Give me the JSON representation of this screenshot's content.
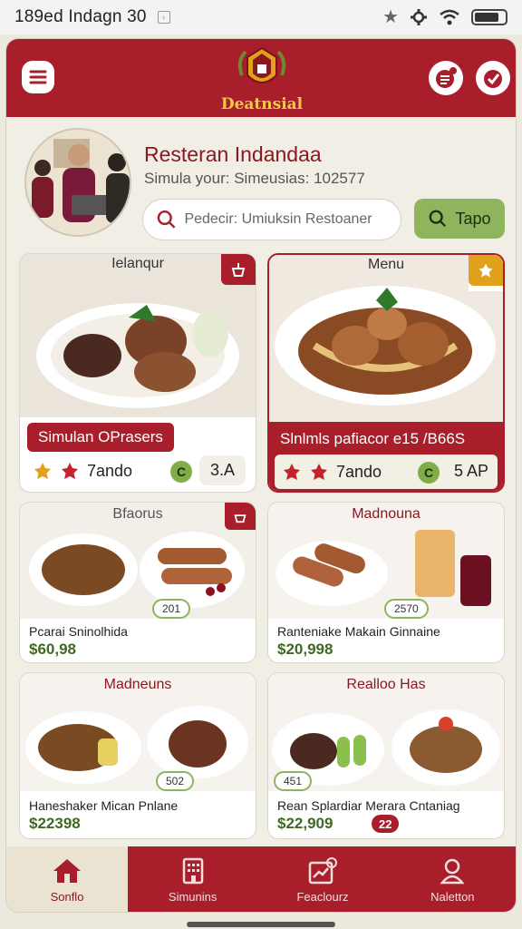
{
  "status_bar": {
    "time": "189ed Indagn 30"
  },
  "header": {
    "brand": "Deatnsial",
    "accent": "#a81e2a"
  },
  "restaurant": {
    "title": "Resteran Indandaa",
    "subtitle": "Simula your: Simeusias: 102577"
  },
  "search": {
    "placeholder": "Pedecir: Umiuksin Restoaner",
    "button_label": "Tapo"
  },
  "featured": [
    {
      "title": "Ielanqur",
      "banner": "Simulan OPrasers",
      "rating_label": "7ando",
      "pill": "3.A"
    },
    {
      "title": "Menu",
      "banner": "Slnlmls pafiacor e15 /B66S",
      "rating_label": "7ando",
      "pill": "5 AP"
    }
  ],
  "items": [
    {
      "title": "Bfaorus",
      "qty": "201",
      "name": "Pcarai Sninolhida",
      "price": "$60,98"
    },
    {
      "title": "Madnouna",
      "qty": "2570",
      "name": "Ranteniake Makain Ginnaine",
      "price": "$20,998"
    },
    {
      "title": "Madneuns",
      "qty": "502",
      "name": "Haneshaker Mican Pnlane",
      "price": "$22398"
    },
    {
      "title": "Realloo Has",
      "qty": "451",
      "name": "Rean Splardiar  Merara Cntaniag",
      "price": "$22,909",
      "badge": "22"
    }
  ],
  "nav": [
    {
      "label": "Sonflo",
      "icon": "home-icon"
    },
    {
      "label": "Simunins",
      "icon": "building-icon"
    },
    {
      "label": "Feaclourz",
      "icon": "chart-icon"
    },
    {
      "label": "Naletton",
      "icon": "user-icon"
    }
  ]
}
